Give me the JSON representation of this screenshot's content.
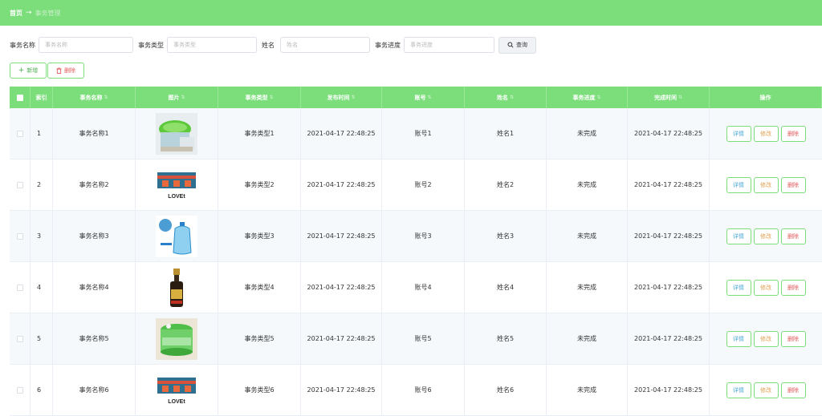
{
  "breadcrumb": {
    "home": "首页",
    "arrow": "→",
    "current": "事务管理"
  },
  "search": {
    "fields": [
      {
        "label": "事务名称",
        "placeholder": "事务名称"
      },
      {
        "label": "事务类型",
        "placeholder": "事务类型"
      },
      {
        "label": "姓名",
        "placeholder": "姓名"
      },
      {
        "label": "事务进度",
        "placeholder": "事务进度"
      }
    ],
    "button_icon": "search-icon",
    "button_label": "查询"
  },
  "actions": {
    "add_icon": "plus-icon",
    "add_label": "新增",
    "delete_icon": "trash-icon",
    "delete_label": "删除"
  },
  "table": {
    "headers": [
      "索引",
      "事务名称",
      "图片",
      "事务类型",
      "发布时间",
      "账号",
      "姓名",
      "事务进度",
      "完成时间",
      "操作"
    ],
    "op_labels": {
      "detail": "详情",
      "edit": "修改",
      "delete": "删除"
    },
    "rows": [
      {
        "index": "1",
        "name": "事务名称1",
        "image": "green-colander-photo",
        "type": "事务类型1",
        "publish_time": "2021-04-17 22:48:25",
        "account": "账号1",
        "username": "姓名1",
        "progress": "未完成",
        "finish_time": "2021-04-17 22:48:25"
      },
      {
        "index": "2",
        "name": "事务名称2",
        "image": "storage-box-photo",
        "type": "事务类型2",
        "publish_time": "2021-04-17 22:48:25",
        "account": "账号2",
        "username": "姓名2",
        "progress": "未完成",
        "finish_time": "2021-04-17 22:48:25"
      },
      {
        "index": "3",
        "name": "事务名称3",
        "image": "water-bottle-photo",
        "type": "事务类型3",
        "publish_time": "2021-04-17 22:48:25",
        "account": "账号3",
        "username": "姓名3",
        "progress": "未完成",
        "finish_time": "2021-04-17 22:48:25"
      },
      {
        "index": "4",
        "name": "事务名称4",
        "image": "sauce-bottle-photo",
        "type": "事务类型4",
        "publish_time": "2021-04-17 22:48:25",
        "account": "账号4",
        "username": "姓名4",
        "progress": "未完成",
        "finish_time": "2021-04-17 22:48:25"
      },
      {
        "index": "5",
        "name": "事务名称5",
        "image": "green-basket-photo",
        "type": "事务类型5",
        "publish_time": "2021-04-17 22:48:25",
        "account": "账号5",
        "username": "姓名5",
        "progress": "未完成",
        "finish_time": "2021-04-17 22:48:25"
      },
      {
        "index": "6",
        "name": "事务名称6",
        "image": "storage-box-photo",
        "type": "事务类型6",
        "publish_time": "2021-04-17 22:48:25",
        "account": "账号6",
        "username": "姓名6",
        "progress": "未完成",
        "finish_time": "2021-04-17 22:48:25"
      }
    ]
  },
  "colors": {
    "accent": "#7bde7b",
    "row_alt": "#f5f9fb",
    "detail": "#4aa8d8",
    "edit": "#e0a050",
    "delete": "#e05a5a"
  }
}
